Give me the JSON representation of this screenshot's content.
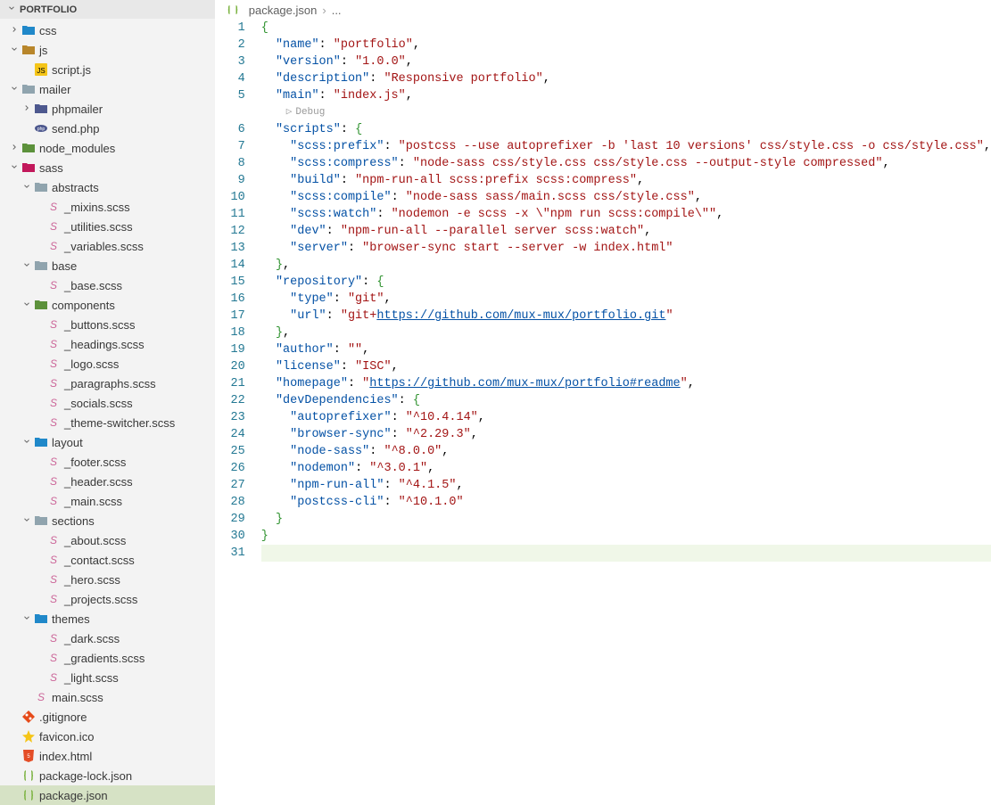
{
  "sidebar": {
    "title": "PORTFOLIO",
    "tree": [
      {
        "depth": 0,
        "twisty": ">",
        "icon": "folder-blue",
        "label": "css"
      },
      {
        "depth": 0,
        "twisty": "v",
        "icon": "folder",
        "label": "js"
      },
      {
        "depth": 1,
        "twisty": "",
        "icon": "js",
        "label": "script.js"
      },
      {
        "depth": 0,
        "twisty": "v",
        "icon": "folder-gray",
        "label": "mailer"
      },
      {
        "depth": 1,
        "twisty": ">",
        "icon": "folder-php",
        "label": "phpmailer"
      },
      {
        "depth": 1,
        "twisty": "",
        "icon": "php",
        "label": "send.php"
      },
      {
        "depth": 0,
        "twisty": ">",
        "icon": "folder-green",
        "label": "node_modules"
      },
      {
        "depth": 0,
        "twisty": "v",
        "icon": "folder-pink",
        "label": "sass"
      },
      {
        "depth": 1,
        "twisty": "v",
        "icon": "folder-gray",
        "label": "abstracts"
      },
      {
        "depth": 2,
        "twisty": "",
        "icon": "sass",
        "label": "_mixins.scss"
      },
      {
        "depth": 2,
        "twisty": "",
        "icon": "sass",
        "label": "_utilities.scss"
      },
      {
        "depth": 2,
        "twisty": "",
        "icon": "sass",
        "label": "_variables.scss"
      },
      {
        "depth": 1,
        "twisty": "v",
        "icon": "folder-gray",
        "label": "base"
      },
      {
        "depth": 2,
        "twisty": "",
        "icon": "sass",
        "label": "_base.scss"
      },
      {
        "depth": 1,
        "twisty": "v",
        "icon": "folder-green",
        "label": "components"
      },
      {
        "depth": 2,
        "twisty": "",
        "icon": "sass",
        "label": "_buttons.scss"
      },
      {
        "depth": 2,
        "twisty": "",
        "icon": "sass",
        "label": "_headings.scss"
      },
      {
        "depth": 2,
        "twisty": "",
        "icon": "sass",
        "label": "_logo.scss"
      },
      {
        "depth": 2,
        "twisty": "",
        "icon": "sass",
        "label": "_paragraphs.scss"
      },
      {
        "depth": 2,
        "twisty": "",
        "icon": "sass",
        "label": "_socials.scss"
      },
      {
        "depth": 2,
        "twisty": "",
        "icon": "sass",
        "label": "_theme-switcher.scss"
      },
      {
        "depth": 1,
        "twisty": "v",
        "icon": "folder-blue",
        "label": "layout"
      },
      {
        "depth": 2,
        "twisty": "",
        "icon": "sass",
        "label": "_footer.scss"
      },
      {
        "depth": 2,
        "twisty": "",
        "icon": "sass",
        "label": "_header.scss"
      },
      {
        "depth": 2,
        "twisty": "",
        "icon": "sass",
        "label": "_main.scss"
      },
      {
        "depth": 1,
        "twisty": "v",
        "icon": "folder-gray",
        "label": "sections"
      },
      {
        "depth": 2,
        "twisty": "",
        "icon": "sass",
        "label": "_about.scss"
      },
      {
        "depth": 2,
        "twisty": "",
        "icon": "sass",
        "label": "_contact.scss"
      },
      {
        "depth": 2,
        "twisty": "",
        "icon": "sass",
        "label": "_hero.scss"
      },
      {
        "depth": 2,
        "twisty": "",
        "icon": "sass",
        "label": "_projects.scss"
      },
      {
        "depth": 1,
        "twisty": "v",
        "icon": "folder-blue",
        "label": "themes"
      },
      {
        "depth": 2,
        "twisty": "",
        "icon": "sass",
        "label": "_dark.scss"
      },
      {
        "depth": 2,
        "twisty": "",
        "icon": "sass",
        "label": "_gradients.scss"
      },
      {
        "depth": 2,
        "twisty": "",
        "icon": "sass",
        "label": "_light.scss"
      },
      {
        "depth": 1,
        "twisty": "",
        "icon": "sass",
        "label": "main.scss"
      },
      {
        "depth": 0,
        "twisty": "",
        "icon": "git",
        "label": ".gitignore"
      },
      {
        "depth": 0,
        "twisty": "",
        "icon": "fav",
        "label": "favicon.ico"
      },
      {
        "depth": 0,
        "twisty": "",
        "icon": "html",
        "label": "index.html"
      },
      {
        "depth": 0,
        "twisty": "",
        "icon": "json",
        "label": "package-lock.json"
      },
      {
        "depth": 0,
        "twisty": "",
        "icon": "json",
        "label": "package.json",
        "selected": true
      }
    ]
  },
  "editor": {
    "breadcrumb": {
      "file": "package.json",
      "sep": "›",
      "more": "..."
    },
    "codelens": {
      "play": "▷",
      "label": "Debug"
    },
    "lines": [
      {
        "n": 1,
        "tokens": [
          [
            "brace",
            "{"
          ]
        ]
      },
      {
        "n": 2,
        "tokens": [
          [
            "ind",
            "  "
          ],
          [
            "key",
            "\"name\""
          ],
          [
            "colon",
            ": "
          ],
          [
            "str",
            "\"portfolio\""
          ],
          [
            "punc",
            ","
          ]
        ]
      },
      {
        "n": 3,
        "tokens": [
          [
            "ind",
            "  "
          ],
          [
            "key",
            "\"version\""
          ],
          [
            "colon",
            ": "
          ],
          [
            "str",
            "\"1.0.0\""
          ],
          [
            "punc",
            ","
          ]
        ]
      },
      {
        "n": 4,
        "tokens": [
          [
            "ind",
            "  "
          ],
          [
            "key",
            "\"description\""
          ],
          [
            "colon",
            ": "
          ],
          [
            "str",
            "\"Responsive portfolio\""
          ],
          [
            "punc",
            ","
          ]
        ]
      },
      {
        "n": 5,
        "tokens": [
          [
            "ind",
            "  "
          ],
          [
            "key",
            "\"main\""
          ],
          [
            "colon",
            ": "
          ],
          [
            "str",
            "\"index.js\""
          ],
          [
            "punc",
            ","
          ]
        ]
      },
      {
        "codelens": true
      },
      {
        "n": 6,
        "tokens": [
          [
            "ind",
            "  "
          ],
          [
            "key",
            "\"scripts\""
          ],
          [
            "colon",
            ": "
          ],
          [
            "brace",
            "{"
          ]
        ]
      },
      {
        "n": 7,
        "tokens": [
          [
            "ind",
            "    "
          ],
          [
            "key",
            "\"scss:prefix\""
          ],
          [
            "colon",
            ": "
          ],
          [
            "str",
            "\"postcss --use autoprefixer -b 'last 10 versions' css/style.css -o css/style.css\""
          ],
          [
            "punc",
            ","
          ]
        ]
      },
      {
        "n": 8,
        "tokens": [
          [
            "ind",
            "    "
          ],
          [
            "key",
            "\"scss:compress\""
          ],
          [
            "colon",
            ": "
          ],
          [
            "str",
            "\"node-sass css/style.css css/style.css --output-style compressed\""
          ],
          [
            "punc",
            ","
          ]
        ]
      },
      {
        "n": 9,
        "tokens": [
          [
            "ind",
            "    "
          ],
          [
            "key",
            "\"build\""
          ],
          [
            "colon",
            ": "
          ],
          [
            "str",
            "\"npm-run-all scss:prefix scss:compress\""
          ],
          [
            "punc",
            ","
          ]
        ]
      },
      {
        "n": 10,
        "tokens": [
          [
            "ind",
            "    "
          ],
          [
            "key",
            "\"scss:compile\""
          ],
          [
            "colon",
            ": "
          ],
          [
            "str",
            "\"node-sass sass/main.scss css/style.css\""
          ],
          [
            "punc",
            ","
          ]
        ]
      },
      {
        "n": 11,
        "tokens": [
          [
            "ind",
            "    "
          ],
          [
            "key",
            "\"scss:watch\""
          ],
          [
            "colon",
            ": "
          ],
          [
            "str",
            "\"nodemon -e scss -x \\\"npm run scss:compile\\\"\""
          ],
          [
            "punc",
            ","
          ]
        ]
      },
      {
        "n": 12,
        "tokens": [
          [
            "ind",
            "    "
          ],
          [
            "key",
            "\"dev\""
          ],
          [
            "colon",
            ": "
          ],
          [
            "str",
            "\"npm-run-all --parallel server scss:watch\""
          ],
          [
            "punc",
            ","
          ]
        ]
      },
      {
        "n": 13,
        "tokens": [
          [
            "ind",
            "    "
          ],
          [
            "key",
            "\"server\""
          ],
          [
            "colon",
            ": "
          ],
          [
            "str",
            "\"browser-sync start --server -w index.html\""
          ]
        ]
      },
      {
        "n": 14,
        "tokens": [
          [
            "ind",
            "  "
          ],
          [
            "brace",
            "}"
          ],
          [
            "punc",
            ","
          ]
        ]
      },
      {
        "n": 15,
        "tokens": [
          [
            "ind",
            "  "
          ],
          [
            "key",
            "\"repository\""
          ],
          [
            "colon",
            ": "
          ],
          [
            "brace",
            "{"
          ]
        ]
      },
      {
        "n": 16,
        "tokens": [
          [
            "ind",
            "    "
          ],
          [
            "key",
            "\"type\""
          ],
          [
            "colon",
            ": "
          ],
          [
            "str",
            "\"git\""
          ],
          [
            "punc",
            ","
          ]
        ]
      },
      {
        "n": 17,
        "tokens": [
          [
            "ind",
            "    "
          ],
          [
            "key",
            "\"url\""
          ],
          [
            "colon",
            ": "
          ],
          [
            "str",
            "\"git+"
          ],
          [
            "link",
            "https://github.com/mux-mux/portfolio.git"
          ],
          [
            "str",
            "\""
          ]
        ]
      },
      {
        "n": 18,
        "tokens": [
          [
            "ind",
            "  "
          ],
          [
            "brace",
            "}"
          ],
          [
            "punc",
            ","
          ]
        ]
      },
      {
        "n": 19,
        "tokens": [
          [
            "ind",
            "  "
          ],
          [
            "key",
            "\"author\""
          ],
          [
            "colon",
            ": "
          ],
          [
            "str",
            "\"\""
          ],
          [
            "punc",
            ","
          ]
        ]
      },
      {
        "n": 20,
        "tokens": [
          [
            "ind",
            "  "
          ],
          [
            "key",
            "\"license\""
          ],
          [
            "colon",
            ": "
          ],
          [
            "str",
            "\"ISC\""
          ],
          [
            "punc",
            ","
          ]
        ]
      },
      {
        "n": 21,
        "tokens": [
          [
            "ind",
            "  "
          ],
          [
            "key",
            "\"homepage\""
          ],
          [
            "colon",
            ": "
          ],
          [
            "str",
            "\""
          ],
          [
            "link",
            "https://github.com/mux-mux/portfolio#readme"
          ],
          [
            "str",
            "\""
          ],
          [
            "punc",
            ","
          ]
        ]
      },
      {
        "n": 22,
        "tokens": [
          [
            "ind",
            "  "
          ],
          [
            "key",
            "\"devDependencies\""
          ],
          [
            "colon",
            ": "
          ],
          [
            "brace",
            "{"
          ]
        ]
      },
      {
        "n": 23,
        "tokens": [
          [
            "ind",
            "    "
          ],
          [
            "key",
            "\"autoprefixer\""
          ],
          [
            "colon",
            ": "
          ],
          [
            "str",
            "\"^10.4.14\""
          ],
          [
            "punc",
            ","
          ]
        ]
      },
      {
        "n": 24,
        "tokens": [
          [
            "ind",
            "    "
          ],
          [
            "key",
            "\"browser-sync\""
          ],
          [
            "colon",
            ": "
          ],
          [
            "str",
            "\"^2.29.3\""
          ],
          [
            "punc",
            ","
          ]
        ]
      },
      {
        "n": 25,
        "tokens": [
          [
            "ind",
            "    "
          ],
          [
            "key",
            "\"node-sass\""
          ],
          [
            "colon",
            ": "
          ],
          [
            "str",
            "\"^8.0.0\""
          ],
          [
            "punc",
            ","
          ]
        ]
      },
      {
        "n": 26,
        "tokens": [
          [
            "ind",
            "    "
          ],
          [
            "key",
            "\"nodemon\""
          ],
          [
            "colon",
            ": "
          ],
          [
            "str",
            "\"^3.0.1\""
          ],
          [
            "punc",
            ","
          ]
        ]
      },
      {
        "n": 27,
        "tokens": [
          [
            "ind",
            "    "
          ],
          [
            "key",
            "\"npm-run-all\""
          ],
          [
            "colon",
            ": "
          ],
          [
            "str",
            "\"^4.1.5\""
          ],
          [
            "punc",
            ","
          ]
        ]
      },
      {
        "n": 28,
        "tokens": [
          [
            "ind",
            "    "
          ],
          [
            "key",
            "\"postcss-cli\""
          ],
          [
            "colon",
            ": "
          ],
          [
            "str",
            "\"^10.1.0\""
          ]
        ]
      },
      {
        "n": 29,
        "tokens": [
          [
            "ind",
            "  "
          ],
          [
            "brace",
            "}"
          ]
        ]
      },
      {
        "n": 30,
        "tokens": [
          [
            "brace",
            "}"
          ]
        ]
      },
      {
        "n": 31,
        "highlight": true,
        "tokens": []
      }
    ]
  }
}
